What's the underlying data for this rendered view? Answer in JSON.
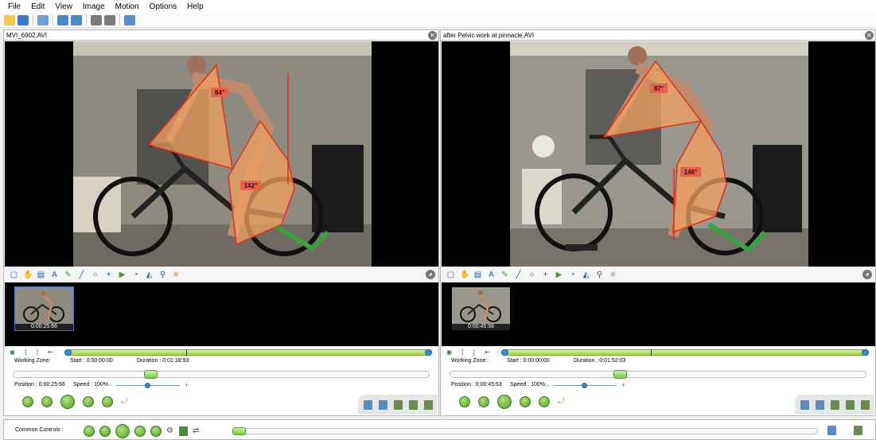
{
  "menu": [
    "File",
    "Edit",
    "View",
    "Image",
    "Motion",
    "Options",
    "Help"
  ],
  "toolbar_icons": [
    "open-folder-icon",
    "save-icon",
    "layout-single-icon",
    "open-video-icon",
    "open-video-2-icon",
    "dual-view-icon",
    "dual-view-2-icon",
    "capture-icon"
  ],
  "panes": [
    {
      "title": "MVI_6902.AVI",
      "angle1": "84°",
      "angle2": "142°",
      "thumb_time": "0:00:25:66",
      "working_zone_label": "Working Zone:",
      "start": "Start : 0:00:00:00",
      "duration": "Duration : 0:01:18:93",
      "position": "Position : 0:00:25:66",
      "speed": "Speed : 100%"
    },
    {
      "title": "after Pelvic work at pinnacle.AVI",
      "angle1": "87°",
      "angle2": "146°",
      "thumb_time": "0:00:45:56",
      "working_zone_label": "Working Zone:",
      "start": "Start : 0:00:00:00",
      "duration": "Duration : 0:01:52:03",
      "position": "Position : 0:00:45:53",
      "speed": "Speed : 100%"
    }
  ],
  "common": {
    "label": "Common Controls :"
  },
  "colors": {
    "angle_fill": "#f0a060",
    "angle_stroke": "#e03020",
    "play_green": "#4e9a26",
    "track_green": "#a8d050",
    "handle_blue": "#3b8fd6"
  }
}
